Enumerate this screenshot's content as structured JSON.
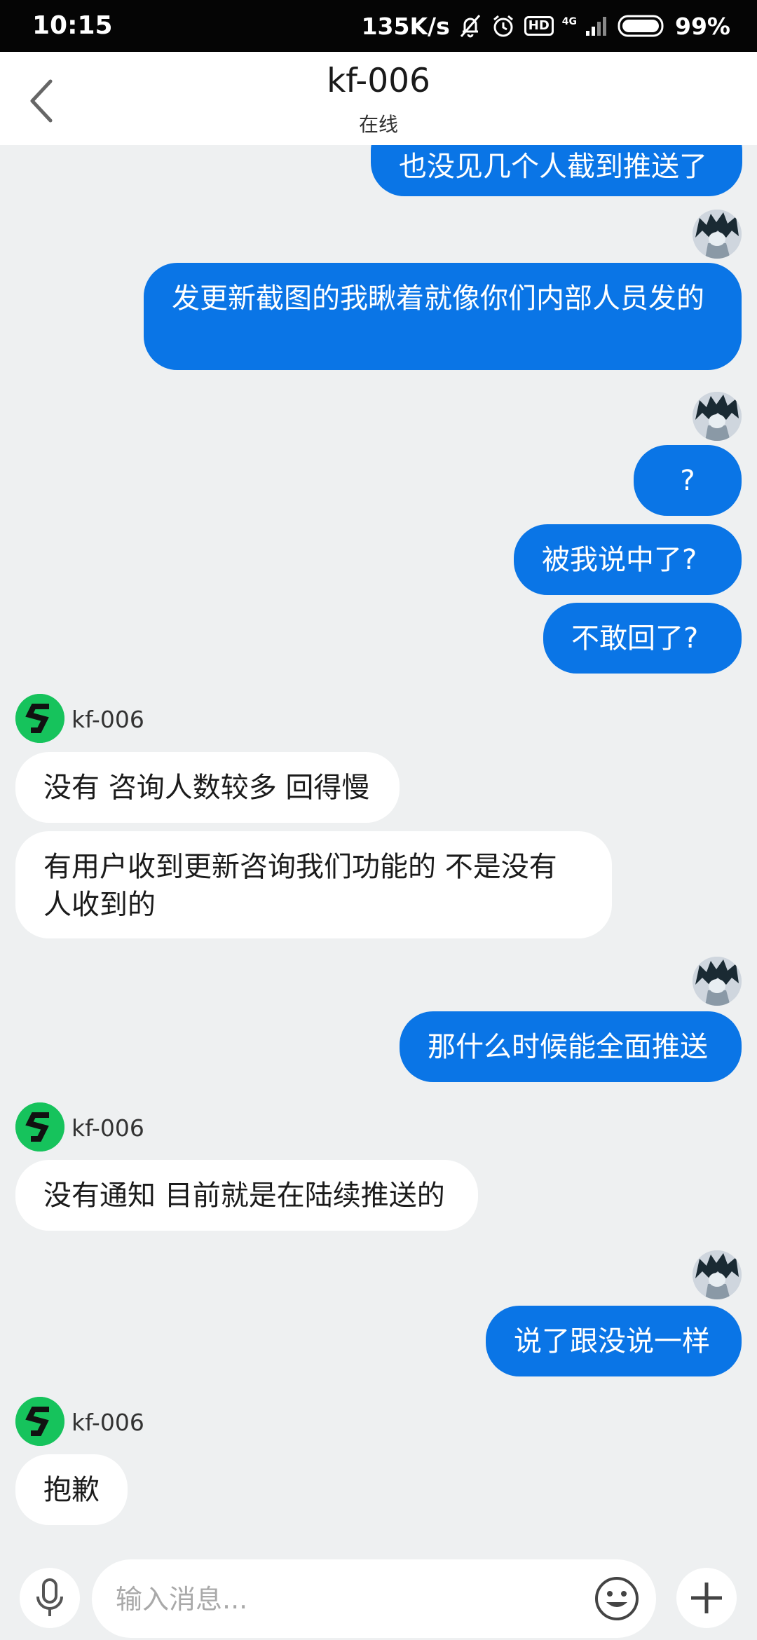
{
  "status_bar": {
    "time": "10:15",
    "speed": "135K/s",
    "hd": "HD",
    "network": "4G",
    "battery": "99%"
  },
  "header": {
    "title": "kf-006",
    "status": "在线"
  },
  "messages": [
    {
      "from": "me",
      "text": "也没见几个人截到推送了"
    },
    {
      "from": "me",
      "text": "发更新截图的我瞅着就像你们内部人员发的"
    },
    {
      "from": "me",
      "text": "?"
    },
    {
      "from": "me",
      "text": "被我说中了?"
    },
    {
      "from": "me",
      "text": "不敢回了?"
    },
    {
      "from": "kf",
      "sender": "kf-006",
      "text": "没有 咨询人数较多 回得慢"
    },
    {
      "from": "kf",
      "text": "有用户收到更新咨询我们功能的 不是没有人收到的"
    },
    {
      "from": "me",
      "text": "那什么时候能全面推送"
    },
    {
      "from": "kf",
      "sender": "kf-006",
      "text": "没有通知 目前就是在陆续推送的"
    },
    {
      "from": "me",
      "text": "说了跟没说一样"
    },
    {
      "from": "kf",
      "sender": "kf-006",
      "text": "抱歉"
    }
  ],
  "input": {
    "placeholder": "输入消息..."
  },
  "colors": {
    "my_bubble": "#0a75e6",
    "their_bubble": "#ffffff",
    "background": "#eef0f1",
    "kf_avatar": "#16c35c"
  },
  "icons": [
    "back-icon",
    "mic-icon",
    "emoji-icon",
    "plus-icon",
    "kf-logo-icon",
    "user-avatar"
  ]
}
